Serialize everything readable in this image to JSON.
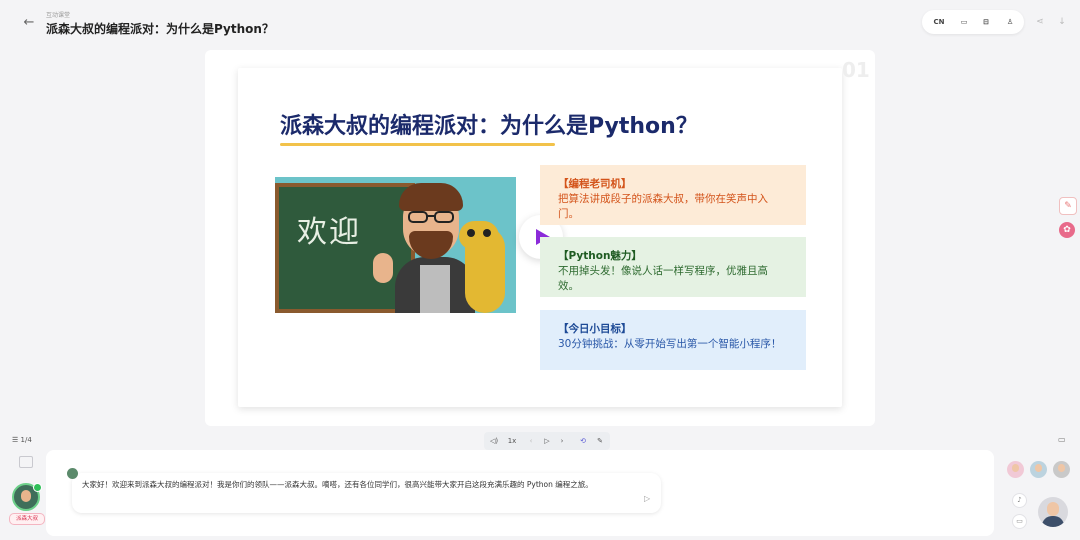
{
  "header": {
    "breadcrumb": "互动课堂",
    "title": "派森大叔的编程派对：为什么是Python？",
    "lang_label": "CN"
  },
  "slide": {
    "number": "01",
    "title": "派森大叔的编程派对：为什么是Python？",
    "illustration_text": "欢迎",
    "cards": [
      {
        "heading": "【编程老司机】",
        "body": "把算法讲成段子的派森大叔，带你在笑声中入门。"
      },
      {
        "heading": "【Python魅力】",
        "body": "不用掉头发！像说人话一样写程序，优雅且高效。"
      },
      {
        "heading": "【今日小目标】",
        "body": "30分钟挑战：从零开始写出第一个智能小程序！"
      }
    ]
  },
  "controls": {
    "page_indicator": "1/4",
    "speed": "1x"
  },
  "chat": {
    "teacher_label": "派森大叔",
    "message": "大家好！欢迎来到派森大叔的编程派对！我是你们的领队——派森大叔。嘀嗒，还有各位同学们，很高兴能带大家开启这段充满乐趣的 Python 编程之旅。"
  },
  "colors": {
    "title_navy": "#1b2a6b",
    "accent_yellow": "#f2c24a",
    "play_purple": "#8b2bd9",
    "card1_bg": "#fdebd7",
    "card2_bg": "#e5f2e3",
    "card3_bg": "#e1eefb"
  }
}
